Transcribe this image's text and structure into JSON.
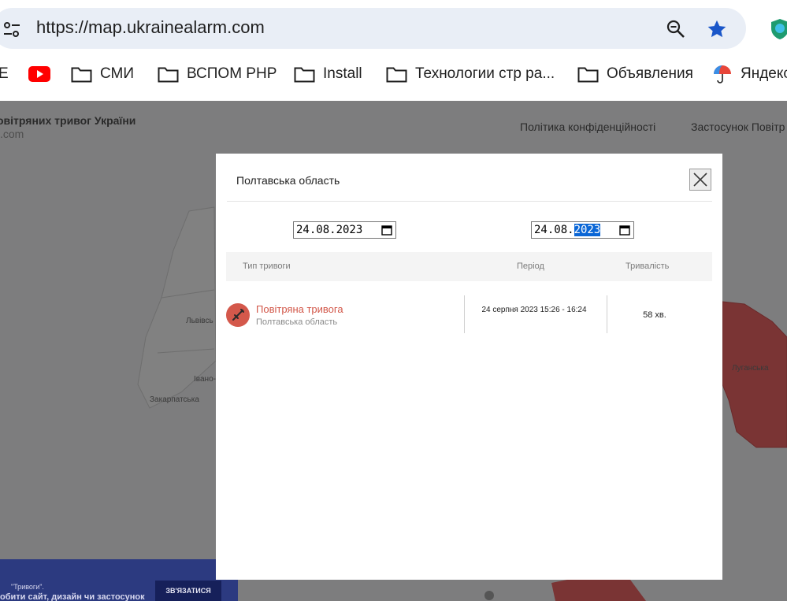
{
  "browser": {
    "url": "https://map.ukrainealarm.com",
    "bookmarks": [
      {
        "label": "E",
        "icon": "partial-text"
      },
      {
        "label": "",
        "icon": "youtube-icon"
      },
      {
        "label": "СМИ",
        "icon": "folder-icon"
      },
      {
        "label": "ВСПОМ PHP",
        "icon": "folder-icon"
      },
      {
        "label": "Install",
        "icon": "folder-icon"
      },
      {
        "label": "Технологии стр ра...",
        "icon": "folder-icon"
      },
      {
        "label": "Объявления",
        "icon": "folder-icon"
      },
      {
        "label": "Яндекс",
        "icon": "yandex-icon"
      }
    ]
  },
  "page": {
    "site_title": "овітряних тривог України",
    "site_subtitle": ".com",
    "nav": {
      "privacy": "Політика конфіденційності",
      "app": "Застосунок Повітр"
    },
    "map_labels": [
      "Львівсь",
      "Івано-",
      "Закарпатська",
      "Луганська"
    ],
    "banner": {
      "small_text": "\"Тривоги\".",
      "big_text": "обити сайт, дизайн чи застосунок",
      "button": "ЗВ'ЯЗАТИСЯ"
    }
  },
  "modal": {
    "title": "Полтавська область",
    "date_from": "24.08.2023",
    "date_to": {
      "prefix": "24.08.",
      "selected": "2023"
    },
    "columns": {
      "type": "Тип тривоги",
      "period": "Період",
      "duration": "Тривалість"
    },
    "rows": [
      {
        "type": "Повітряна тривога",
        "region": "Полтавська область",
        "period": "24 серпня 2023 15:26 - 16:24",
        "duration": "58 хв."
      }
    ]
  },
  "colors": {
    "overlay": "#7d7d7e",
    "alert_red": "#d4584b",
    "selection_blue": "#0a66d6",
    "banner_blue": "#2c3a80"
  }
}
